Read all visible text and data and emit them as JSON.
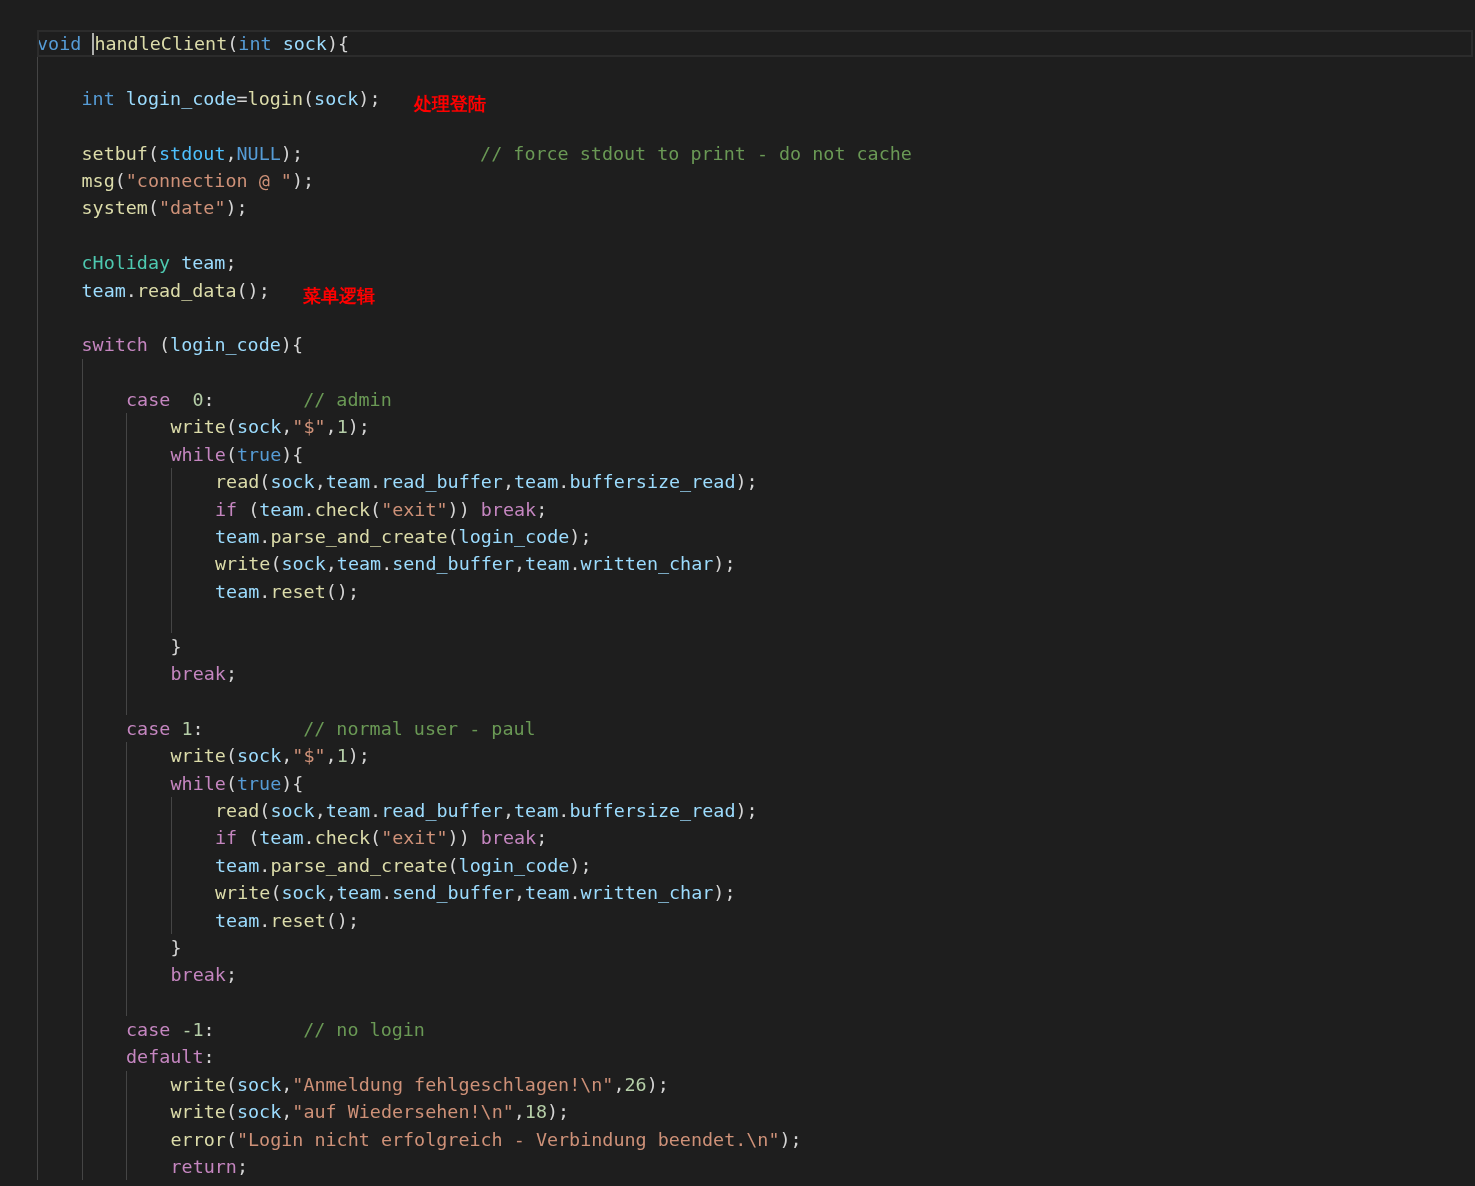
{
  "editor": {
    "lines": [
      {
        "kind": "line",
        "current": true,
        "tokens": [
          {
            "t": "void ",
            "kind": "kw"
          },
          {
            "t": "handleClient",
            "kind": "fn",
            "cursor": true
          },
          {
            "t": "(",
            "kind": "p"
          },
          {
            "t": "int ",
            "kind": "kw"
          },
          {
            "t": "sock",
            "kind": "var"
          },
          {
            "t": "){",
            "kind": "p"
          }
        ]
      },
      {
        "kind": "block",
        "children": [
          {
            "kind": "blank"
          },
          {
            "kind": "line",
            "tokens": [
              {
                "t": "int ",
                "kind": "kw"
              },
              {
                "t": "login_code",
                "kind": "var"
              },
              {
                "t": "=",
                "kind": "p"
              },
              {
                "t": "login",
                "kind": "fn"
              },
              {
                "t": "(",
                "kind": "p"
              },
              {
                "t": "sock",
                "kind": "var"
              },
              {
                "t": ");",
                "kind": "p"
              }
            ],
            "annotation": "处理登陆"
          },
          {
            "kind": "blank"
          },
          {
            "kind": "line",
            "tokens": [
              {
                "t": "setbuf",
                "kind": "fn"
              },
              {
                "t": "(",
                "kind": "p"
              },
              {
                "t": "stdout",
                "kind": "const"
              },
              {
                "t": ",",
                "kind": "p"
              },
              {
                "t": "NULL",
                "kind": "kw"
              },
              {
                "t": ");",
                "kind": "p"
              }
            ],
            "comment": "// force stdout to print - do not cache"
          },
          {
            "kind": "line",
            "tokens": [
              {
                "t": "msg",
                "kind": "fn"
              },
              {
                "t": "(",
                "kind": "p"
              },
              {
                "t": "\"connection @ \"",
                "kind": "str"
              },
              {
                "t": ");",
                "kind": "p"
              }
            ]
          },
          {
            "kind": "line",
            "tokens": [
              {
                "t": "system",
                "kind": "fn"
              },
              {
                "t": "(",
                "kind": "p"
              },
              {
                "t": "\"date\"",
                "kind": "str"
              },
              {
                "t": ");",
                "kind": "p"
              }
            ]
          },
          {
            "kind": "blank"
          },
          {
            "kind": "line",
            "tokens": [
              {
                "t": "cHoliday ",
                "kind": "type"
              },
              {
                "t": "team",
                "kind": "var"
              },
              {
                "t": ";",
                "kind": "p"
              }
            ]
          },
          {
            "kind": "line",
            "tokens": [
              {
                "t": "team",
                "kind": "var"
              },
              {
                "t": ".",
                "kind": "p"
              },
              {
                "t": "read_data",
                "kind": "fn"
              },
              {
                "t": "();",
                "kind": "p"
              }
            ],
            "annotation": "菜单逻辑"
          },
          {
            "kind": "blank"
          },
          {
            "kind": "line",
            "tokens": [
              {
                "t": "switch ",
                "kind": "ctl"
              },
              {
                "t": "(",
                "kind": "p"
              },
              {
                "t": "login_code",
                "kind": "var"
              },
              {
                "t": "){",
                "kind": "p"
              }
            ]
          },
          {
            "kind": "block",
            "children": [
              {
                "kind": "blank"
              },
              {
                "kind": "line",
                "tokens": [
                  {
                    "t": "case  ",
                    "kind": "ctl"
                  },
                  {
                    "t": "0",
                    "kind": "num"
                  },
                  {
                    "t": ":",
                    "kind": "p"
                  }
                ],
                "comment": "// admin"
              },
              {
                "kind": "block",
                "children": [
                  {
                    "kind": "line",
                    "tokens": [
                      {
                        "t": "write",
                        "kind": "fn"
                      },
                      {
                        "t": "(",
                        "kind": "p"
                      },
                      {
                        "t": "sock",
                        "kind": "var"
                      },
                      {
                        "t": ",",
                        "kind": "p"
                      },
                      {
                        "t": "\"$\"",
                        "kind": "str"
                      },
                      {
                        "t": ",",
                        "kind": "p"
                      },
                      {
                        "t": "1",
                        "kind": "num"
                      },
                      {
                        "t": ");",
                        "kind": "p"
                      }
                    ]
                  },
                  {
                    "kind": "line",
                    "tokens": [
                      {
                        "t": "while",
                        "kind": "ctl"
                      },
                      {
                        "t": "(",
                        "kind": "p"
                      },
                      {
                        "t": "true",
                        "kind": "kw"
                      },
                      {
                        "t": "){",
                        "kind": "p"
                      }
                    ]
                  },
                  {
                    "kind": "block",
                    "children": [
                      {
                        "kind": "line",
                        "tokens": [
                          {
                            "t": "read",
                            "kind": "fn"
                          },
                          {
                            "t": "(",
                            "kind": "p"
                          },
                          {
                            "t": "sock",
                            "kind": "var"
                          },
                          {
                            "t": ",",
                            "kind": "p"
                          },
                          {
                            "t": "team",
                            "kind": "var"
                          },
                          {
                            "t": ".",
                            "kind": "p"
                          },
                          {
                            "t": "read_buffer",
                            "kind": "var"
                          },
                          {
                            "t": ",",
                            "kind": "p"
                          },
                          {
                            "t": "team",
                            "kind": "var"
                          },
                          {
                            "t": ".",
                            "kind": "p"
                          },
                          {
                            "t": "buffersize_read",
                            "kind": "var"
                          },
                          {
                            "t": ");",
                            "kind": "p"
                          }
                        ]
                      },
                      {
                        "kind": "line",
                        "tokens": [
                          {
                            "t": "if ",
                            "kind": "ctl"
                          },
                          {
                            "t": "(",
                            "kind": "p"
                          },
                          {
                            "t": "team",
                            "kind": "var"
                          },
                          {
                            "t": ".",
                            "kind": "p"
                          },
                          {
                            "t": "check",
                            "kind": "fn"
                          },
                          {
                            "t": "(",
                            "kind": "p"
                          },
                          {
                            "t": "\"exit\"",
                            "kind": "str"
                          },
                          {
                            "t": ")) ",
                            "kind": "p"
                          },
                          {
                            "t": "break",
                            "kind": "ctl"
                          },
                          {
                            "t": ";",
                            "kind": "p"
                          }
                        ]
                      },
                      {
                        "kind": "line",
                        "tokens": [
                          {
                            "t": "team",
                            "kind": "var"
                          },
                          {
                            "t": ".",
                            "kind": "p"
                          },
                          {
                            "t": "parse_and_create",
                            "kind": "fn"
                          },
                          {
                            "t": "(",
                            "kind": "p"
                          },
                          {
                            "t": "login_code",
                            "kind": "var"
                          },
                          {
                            "t": ");",
                            "kind": "p"
                          }
                        ]
                      },
                      {
                        "kind": "line",
                        "tokens": [
                          {
                            "t": "write",
                            "kind": "fn"
                          },
                          {
                            "t": "(",
                            "kind": "p"
                          },
                          {
                            "t": "sock",
                            "kind": "var"
                          },
                          {
                            "t": ",",
                            "kind": "p"
                          },
                          {
                            "t": "team",
                            "kind": "var"
                          },
                          {
                            "t": ".",
                            "kind": "p"
                          },
                          {
                            "t": "send_buffer",
                            "kind": "var"
                          },
                          {
                            "t": ",",
                            "kind": "p"
                          },
                          {
                            "t": "team",
                            "kind": "var"
                          },
                          {
                            "t": ".",
                            "kind": "p"
                          },
                          {
                            "t": "written_char",
                            "kind": "var"
                          },
                          {
                            "t": ");",
                            "kind": "p"
                          }
                        ]
                      },
                      {
                        "kind": "line",
                        "tokens": [
                          {
                            "t": "team",
                            "kind": "var"
                          },
                          {
                            "t": ".",
                            "kind": "p"
                          },
                          {
                            "t": "reset",
                            "kind": "fn"
                          },
                          {
                            "t": "();",
                            "kind": "p"
                          }
                        ]
                      },
                      {
                        "kind": "blank"
                      }
                    ]
                  },
                  {
                    "kind": "line",
                    "tokens": [
                      {
                        "t": "}",
                        "kind": "p"
                      }
                    ]
                  },
                  {
                    "kind": "line",
                    "tokens": [
                      {
                        "t": "break",
                        "kind": "ctl"
                      },
                      {
                        "t": ";",
                        "kind": "p"
                      }
                    ]
                  },
                  {
                    "kind": "blank"
                  }
                ]
              },
              {
                "kind": "line",
                "tokens": [
                  {
                    "t": "case ",
                    "kind": "ctl"
                  },
                  {
                    "t": "1",
                    "kind": "num"
                  },
                  {
                    "t": ":",
                    "kind": "p"
                  }
                ],
                "comment": "// normal user - paul"
              },
              {
                "kind": "block",
                "children": [
                  {
                    "kind": "line",
                    "tokens": [
                      {
                        "t": "write",
                        "kind": "fn"
                      },
                      {
                        "t": "(",
                        "kind": "p"
                      },
                      {
                        "t": "sock",
                        "kind": "var"
                      },
                      {
                        "t": ",",
                        "kind": "p"
                      },
                      {
                        "t": "\"$\"",
                        "kind": "str"
                      },
                      {
                        "t": ",",
                        "kind": "p"
                      },
                      {
                        "t": "1",
                        "kind": "num"
                      },
                      {
                        "t": ");",
                        "kind": "p"
                      }
                    ]
                  },
                  {
                    "kind": "line",
                    "tokens": [
                      {
                        "t": "while",
                        "kind": "ctl"
                      },
                      {
                        "t": "(",
                        "kind": "p"
                      },
                      {
                        "t": "true",
                        "kind": "kw"
                      },
                      {
                        "t": "){",
                        "kind": "p"
                      }
                    ]
                  },
                  {
                    "kind": "block",
                    "children": [
                      {
                        "kind": "line",
                        "tokens": [
                          {
                            "t": "read",
                            "kind": "fn"
                          },
                          {
                            "t": "(",
                            "kind": "p"
                          },
                          {
                            "t": "sock",
                            "kind": "var"
                          },
                          {
                            "t": ",",
                            "kind": "p"
                          },
                          {
                            "t": "team",
                            "kind": "var"
                          },
                          {
                            "t": ".",
                            "kind": "p"
                          },
                          {
                            "t": "read_buffer",
                            "kind": "var"
                          },
                          {
                            "t": ",",
                            "kind": "p"
                          },
                          {
                            "t": "team",
                            "kind": "var"
                          },
                          {
                            "t": ".",
                            "kind": "p"
                          },
                          {
                            "t": "buffersize_read",
                            "kind": "var"
                          },
                          {
                            "t": ");",
                            "kind": "p"
                          }
                        ]
                      },
                      {
                        "kind": "line",
                        "tokens": [
                          {
                            "t": "if ",
                            "kind": "ctl"
                          },
                          {
                            "t": "(",
                            "kind": "p"
                          },
                          {
                            "t": "team",
                            "kind": "var"
                          },
                          {
                            "t": ".",
                            "kind": "p"
                          },
                          {
                            "t": "check",
                            "kind": "fn"
                          },
                          {
                            "t": "(",
                            "kind": "p"
                          },
                          {
                            "t": "\"exit\"",
                            "kind": "str"
                          },
                          {
                            "t": ")) ",
                            "kind": "p"
                          },
                          {
                            "t": "break",
                            "kind": "ctl"
                          },
                          {
                            "t": ";",
                            "kind": "p"
                          }
                        ]
                      },
                      {
                        "kind": "line",
                        "tokens": [
                          {
                            "t": "team",
                            "kind": "var"
                          },
                          {
                            "t": ".",
                            "kind": "p"
                          },
                          {
                            "t": "parse_and_create",
                            "kind": "fn"
                          },
                          {
                            "t": "(",
                            "kind": "p"
                          },
                          {
                            "t": "login_code",
                            "kind": "var"
                          },
                          {
                            "t": ");",
                            "kind": "p"
                          }
                        ]
                      },
                      {
                        "kind": "line",
                        "tokens": [
                          {
                            "t": "write",
                            "kind": "fn"
                          },
                          {
                            "t": "(",
                            "kind": "p"
                          },
                          {
                            "t": "sock",
                            "kind": "var"
                          },
                          {
                            "t": ",",
                            "kind": "p"
                          },
                          {
                            "t": "team",
                            "kind": "var"
                          },
                          {
                            "t": ".",
                            "kind": "p"
                          },
                          {
                            "t": "send_buffer",
                            "kind": "var"
                          },
                          {
                            "t": ",",
                            "kind": "p"
                          },
                          {
                            "t": "team",
                            "kind": "var"
                          },
                          {
                            "t": ".",
                            "kind": "p"
                          },
                          {
                            "t": "written_char",
                            "kind": "var"
                          },
                          {
                            "t": ");",
                            "kind": "p"
                          }
                        ]
                      },
                      {
                        "kind": "line",
                        "tokens": [
                          {
                            "t": "team",
                            "kind": "var"
                          },
                          {
                            "t": ".",
                            "kind": "p"
                          },
                          {
                            "t": "reset",
                            "kind": "fn"
                          },
                          {
                            "t": "();",
                            "kind": "p"
                          }
                        ]
                      }
                    ]
                  },
                  {
                    "kind": "line",
                    "tokens": [
                      {
                        "t": "}",
                        "kind": "p"
                      }
                    ]
                  },
                  {
                    "kind": "line",
                    "tokens": [
                      {
                        "t": "break",
                        "kind": "ctl"
                      },
                      {
                        "t": ";",
                        "kind": "p"
                      }
                    ]
                  },
                  {
                    "kind": "blank"
                  }
                ]
              },
              {
                "kind": "line",
                "tokens": [
                  {
                    "t": "case ",
                    "kind": "ctl"
                  },
                  {
                    "t": "-1",
                    "kind": "num"
                  },
                  {
                    "t": ":",
                    "kind": "p"
                  }
                ],
                "comment": "// no login"
              },
              {
                "kind": "line",
                "tokens": [
                  {
                    "t": "default",
                    "kind": "ctl"
                  },
                  {
                    "t": ":",
                    "kind": "p"
                  }
                ]
              },
              {
                "kind": "block",
                "children": [
                  {
                    "kind": "line",
                    "tokens": [
                      {
                        "t": "write",
                        "kind": "fn"
                      },
                      {
                        "t": "(",
                        "kind": "p"
                      },
                      {
                        "t": "sock",
                        "kind": "var"
                      },
                      {
                        "t": ",",
                        "kind": "p"
                      },
                      {
                        "t": "\"Anmeldung fehlgeschlagen!\\n\"",
                        "kind": "str"
                      },
                      {
                        "t": ",",
                        "kind": "p"
                      },
                      {
                        "t": "26",
                        "kind": "num"
                      },
                      {
                        "t": ");",
                        "kind": "p"
                      }
                    ]
                  },
                  {
                    "kind": "line",
                    "tokens": [
                      {
                        "t": "write",
                        "kind": "fn"
                      },
                      {
                        "t": "(",
                        "kind": "p"
                      },
                      {
                        "t": "sock",
                        "kind": "var"
                      },
                      {
                        "t": ",",
                        "kind": "p"
                      },
                      {
                        "t": "\"auf Wiedersehen!\\n\"",
                        "kind": "str"
                      },
                      {
                        "t": ",",
                        "kind": "p"
                      },
                      {
                        "t": "18",
                        "kind": "num"
                      },
                      {
                        "t": ");",
                        "kind": "p"
                      }
                    ]
                  },
                  {
                    "kind": "line",
                    "tokens": [
                      {
                        "t": "error",
                        "kind": "fn"
                      },
                      {
                        "t": "(",
                        "kind": "p"
                      },
                      {
                        "t": "\"Login nicht erfolgreich - Verbindung beendet.\\n\"",
                        "kind": "str"
                      },
                      {
                        "t": ");",
                        "kind": "p"
                      }
                    ]
                  },
                  {
                    "kind": "line",
                    "tokens": [
                      {
                        "t": "return",
                        "kind": "ctl"
                      },
                      {
                        "t": ";",
                        "kind": "p"
                      }
                    ]
                  }
                ]
              }
            ]
          }
        ]
      }
    ]
  }
}
